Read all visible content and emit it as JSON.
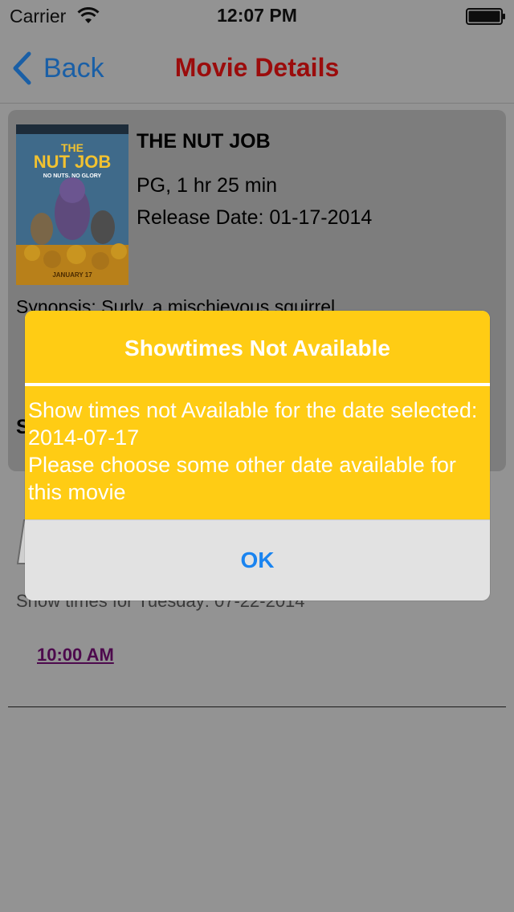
{
  "status_bar": {
    "carrier": "Carrier",
    "time": "12:07 PM",
    "icons": [
      "wifi-icon",
      "battery-icon"
    ]
  },
  "nav": {
    "back_label": "Back",
    "title": "Movie Details",
    "title_color": "#9b0c0c",
    "back_color": "#1a5fa6"
  },
  "movie": {
    "title": "THE NUT JOB",
    "meta": "PG,  1 hr 25 min",
    "release": "Release Date: 01-17-2014",
    "synopsis": "Synopsis: Surly, a mischievous squirrel,",
    "section_heading_fragment": "S",
    "poster": {
      "title_line1": "THE",
      "title_line2": "NUT JOB",
      "tagline": "NO NUTS. NO GLORY",
      "date": "JANUARY 17"
    }
  },
  "showtimes": {
    "heading": "Show times for Tuesday: 07-22-2014",
    "times": [
      "10:00 AM"
    ],
    "link_color": "#4d0a4d"
  },
  "alert": {
    "title": "Showtimes Not Available",
    "message_line1": "Show times not Available for the date selected: 2014-07-17",
    "message_line2": "Please choose some other date available for this movie",
    "ok_label": "OK",
    "accent": "#ffcc14",
    "button_color": "#1a84f0"
  }
}
